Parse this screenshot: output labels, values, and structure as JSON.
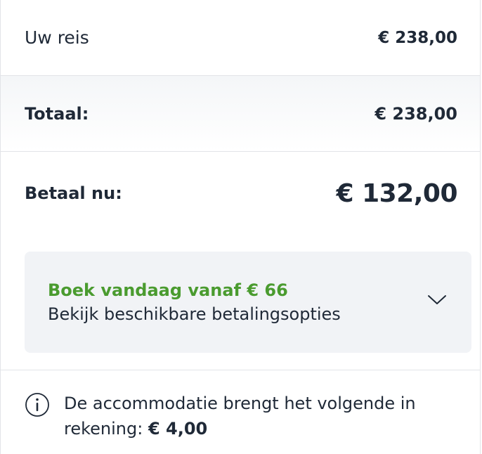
{
  "summary": {
    "trip_label": "Uw reis",
    "trip_amount": "€ 238,00",
    "total_label": "Totaal:",
    "total_amount": "€ 238,00",
    "pay_now_label": "Betaal nu:",
    "pay_now_amount": "€ 132,00"
  },
  "payment_options": {
    "title": "Boek vandaag vanaf € 66",
    "subtitle": "Bekijk beschikbare betalingsopties",
    "title_color": "#4a9b2f",
    "icon": "chevron-down-icon"
  },
  "notice": {
    "icon": "info-icon",
    "text": "De accommodatie brengt het volgende in rekening:",
    "amount": "€ 4,00"
  }
}
